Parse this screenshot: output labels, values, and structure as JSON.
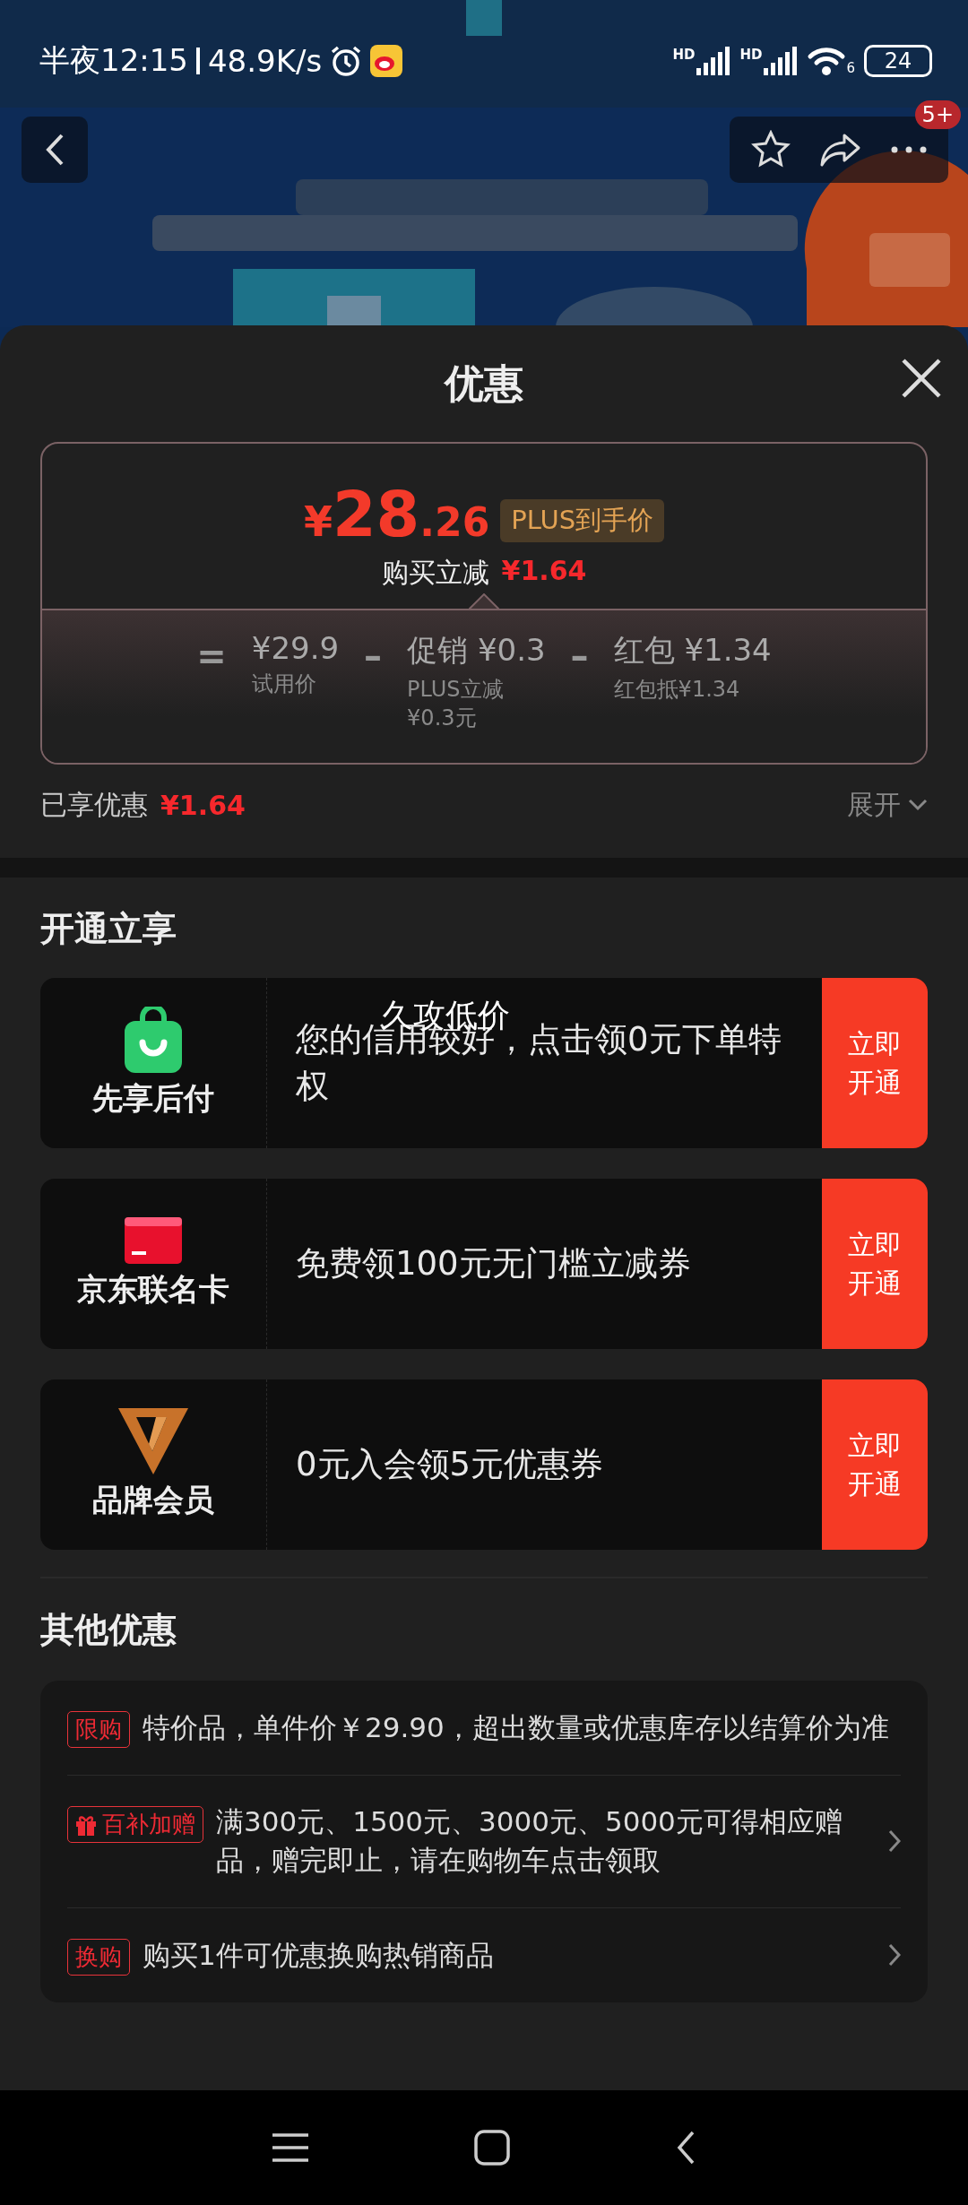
{
  "status_bar": {
    "time": "半夜12:15",
    "speed": "48.9K/s",
    "sim_labels": [
      "HD",
      "HD"
    ],
    "wifi_label": "6",
    "battery": "24"
  },
  "nav": {
    "badge": "5+"
  },
  "sheet": {
    "title": "优惠"
  },
  "price_card": {
    "symbol": "¥",
    "integer": "28",
    "decimal": ".26",
    "tag": "PLUS到手价",
    "reduce_label": "购买立减",
    "reduce_value": "¥1.64",
    "formula": [
      {
        "kind": "op",
        "text": "="
      },
      {
        "kind": "term",
        "value": "¥29.9",
        "note": "试用价"
      },
      {
        "kind": "op",
        "text": "–"
      },
      {
        "kind": "term",
        "label": "促销",
        "value": "¥0.3",
        "note": "PLUS立减¥0.3元"
      },
      {
        "kind": "op",
        "text": "–"
      },
      {
        "kind": "term",
        "label": "红包",
        "value": "¥1.34",
        "note": "红包抵¥1.34"
      }
    ]
  },
  "saved": {
    "label": "已享优惠",
    "value": "¥1.64",
    "expand": "展开"
  },
  "open_section": {
    "title": "开通立享",
    "overlay_text": "久攻低价",
    "items": [
      {
        "kind": "bag",
        "name": "先享后付",
        "desc": "您的信用较好，点击领0元下单特权",
        "button": "立即开通"
      },
      {
        "kind": "card",
        "name": "京东联名卡",
        "desc": "免费领100元无门槛立减券",
        "button": "立即开通"
      },
      {
        "kind": "v",
        "name": "品牌会员",
        "desc": "0元入会领5元优惠券",
        "button": "立即开通"
      }
    ]
  },
  "other_section": {
    "title": "其他优惠",
    "items": [
      {
        "tag": "限购",
        "gift": false,
        "text": "特价品，单件价￥29.90，超出数量或优惠库存以结算价为准",
        "arrow": false
      },
      {
        "tag": "百补加赠",
        "gift": true,
        "text": "满300元、1500元、3000元、5000元可得相应赠品，赠完即止，请在购物车点击领取",
        "arrow": true
      },
      {
        "tag": "换购",
        "gift": false,
        "text": "购买1件可优惠换购热销商品",
        "arrow": true
      }
    ]
  }
}
